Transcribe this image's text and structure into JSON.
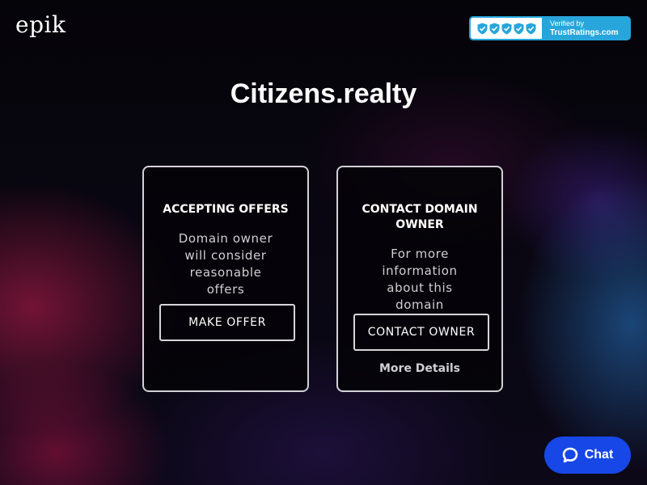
{
  "header": {
    "logo_text": "epik",
    "trust_badge": {
      "line1": "Verified by",
      "line2": "TrustRatings.com",
      "icon": "shield-check-icon",
      "shield_count": 5
    }
  },
  "page": {
    "domain_title": "Citizens.realty"
  },
  "cards": {
    "offers": {
      "heading": "ACCEPTING OFFERS",
      "description": "Domain owner will consider reasonable offers",
      "button_label": "MAKE OFFER"
    },
    "contact": {
      "heading": "CONTACT DOMAIN OWNER",
      "description": "For more information about this domain",
      "button_label": "CONTACT OWNER",
      "link_label": "More Details"
    }
  },
  "chat": {
    "label": "Chat",
    "icon": "chat-bubble-icon"
  },
  "colors": {
    "chat_button": "#1747e6",
    "trust_badge": "#27a6dc",
    "card_border": "#d4d0d8"
  }
}
